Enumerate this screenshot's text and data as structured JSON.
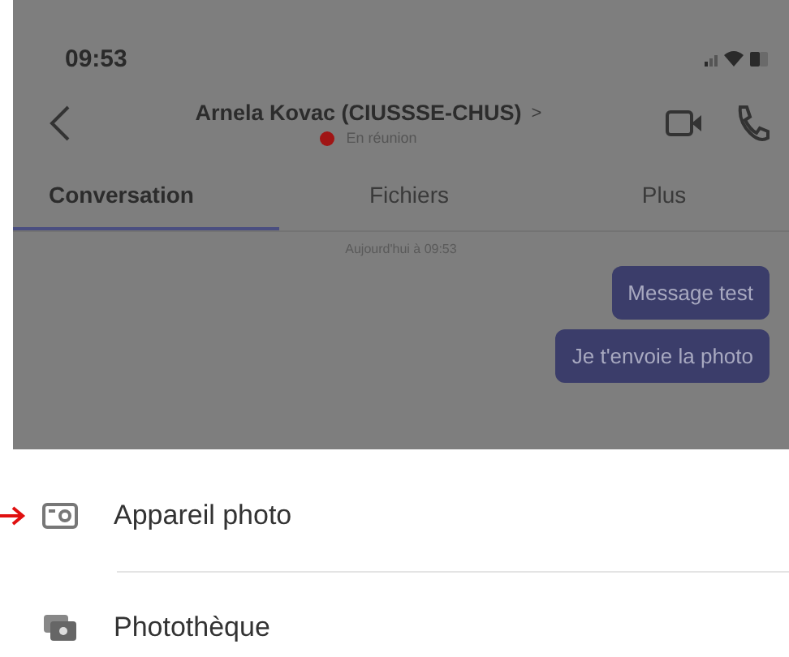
{
  "status_bar": {
    "time": "09:53"
  },
  "header": {
    "contact": "Arnela Kovac (CIUSSSE-CHUS)",
    "chevron": ">",
    "presence": "En réunion"
  },
  "tabs": [
    {
      "label": "Conversation",
      "selected": true
    },
    {
      "label": "Fichiers",
      "selected": false
    },
    {
      "label": "Plus",
      "selected": false
    }
  ],
  "chat": {
    "date": "Aujourd'hui à 09:53",
    "messages": [
      "Message test",
      "Je t'envoie la photo"
    ]
  },
  "sheet": {
    "items": [
      {
        "kind": "camera",
        "label": "Appareil photo"
      },
      {
        "kind": "library",
        "label": "Photothèque"
      }
    ]
  }
}
